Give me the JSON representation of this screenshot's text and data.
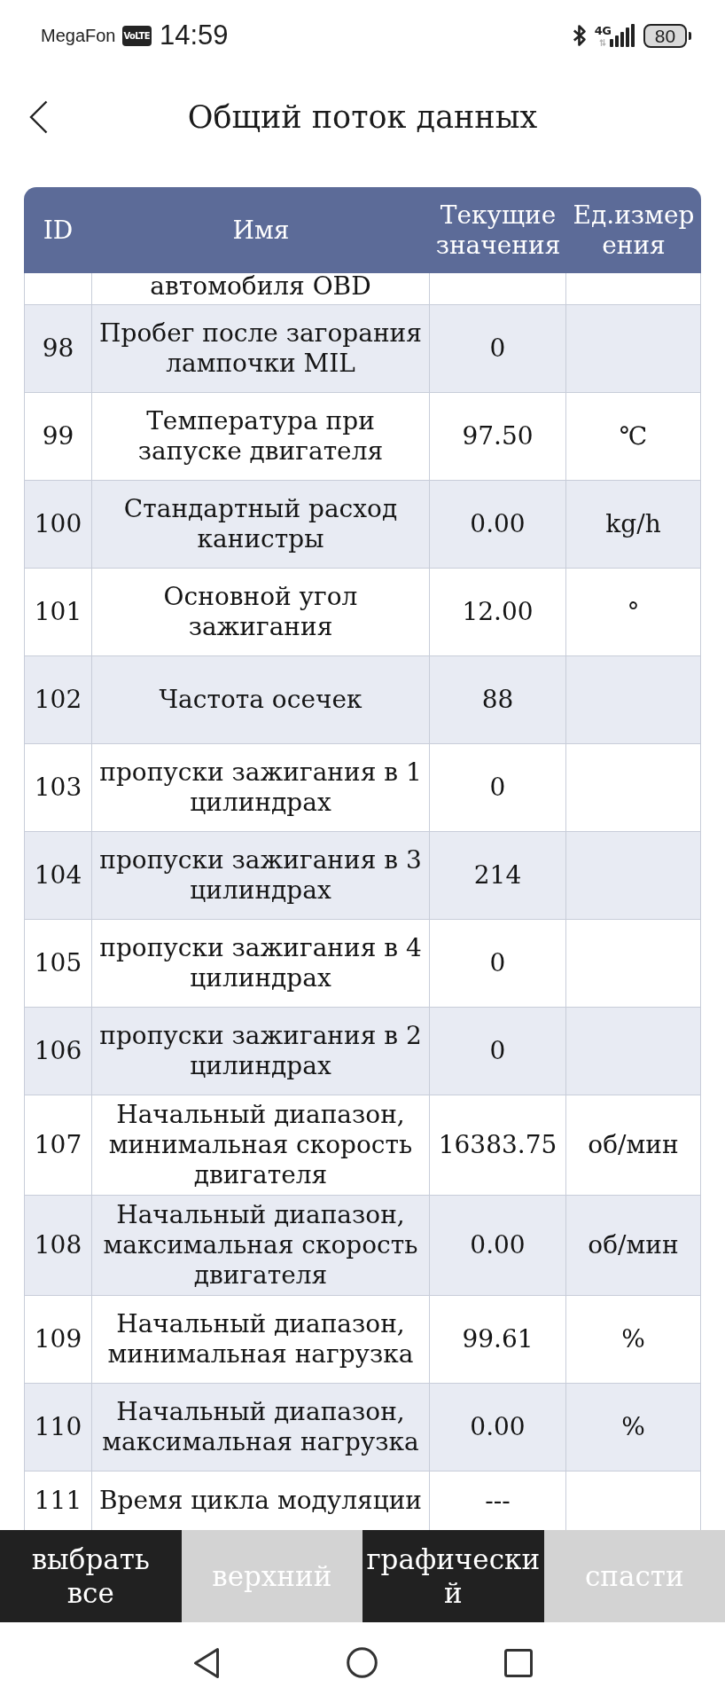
{
  "status_bar": {
    "carrier": "MegaFon",
    "volte": "VoLTE",
    "time": "14:59",
    "network": "4G",
    "battery": "80"
  },
  "header": {
    "title": "Общий поток данных"
  },
  "table": {
    "columns": [
      "ID",
      "Имя",
      "Текущие значения",
      "Ед.измерения"
    ],
    "rows": [
      {
        "name": "автомобиля OBD"
      },
      {
        "id": "98",
        "name": "Пробег после загорания лампочки MIL",
        "value": "0"
      },
      {
        "id": "99",
        "name": "Температура при запуске двигателя",
        "value": "97.50",
        "unit": "℃"
      },
      {
        "id": "100",
        "name": "Стандартный расход канистры",
        "value": "0.00",
        "unit": "kg/h"
      },
      {
        "id": "101",
        "name": "Основной угол зажигания",
        "value": "12.00",
        "unit": "°"
      },
      {
        "id": "102",
        "name": "Частота осечек",
        "value": "88"
      },
      {
        "id": "103",
        "name": "пропуски зажигания в 1 цилиндрах",
        "value": "0"
      },
      {
        "id": "104",
        "name": "пропуски зажигания в 3 цилиндрах",
        "value": "214"
      },
      {
        "id": "105",
        "name": "пропуски зажигания в 4 цилиндрах",
        "value": "0"
      },
      {
        "id": "106",
        "name": "пропуски зажигания в 2 цилиндрах",
        "value": "0"
      },
      {
        "id": "107",
        "name": "Начальный диапазон, минимальная скорость двигателя",
        "value": "16383.75",
        "unit": "об/мин"
      },
      {
        "id": "108",
        "name": "Начальный диапазон, максимальная скорость двигателя",
        "value": "0.00",
        "unit": "об/мин"
      },
      {
        "id": "109",
        "name": "Начальный диапазон, минимальная нагрузка",
        "value": "99.61",
        "unit": "%"
      },
      {
        "id": "110",
        "name": "Начальный диапазон, максимальная нагрузка",
        "value": "0.00",
        "unit": "%"
      },
      {
        "id": "111",
        "name": "Время цикла модуляции",
        "value": "---"
      }
    ]
  },
  "buttons": [
    {
      "label": "выбрать все",
      "disabled": false
    },
    {
      "label": "верхний",
      "disabled": true
    },
    {
      "label": "графический",
      "disabled": false
    },
    {
      "label": "спасти",
      "disabled": true
    }
  ]
}
